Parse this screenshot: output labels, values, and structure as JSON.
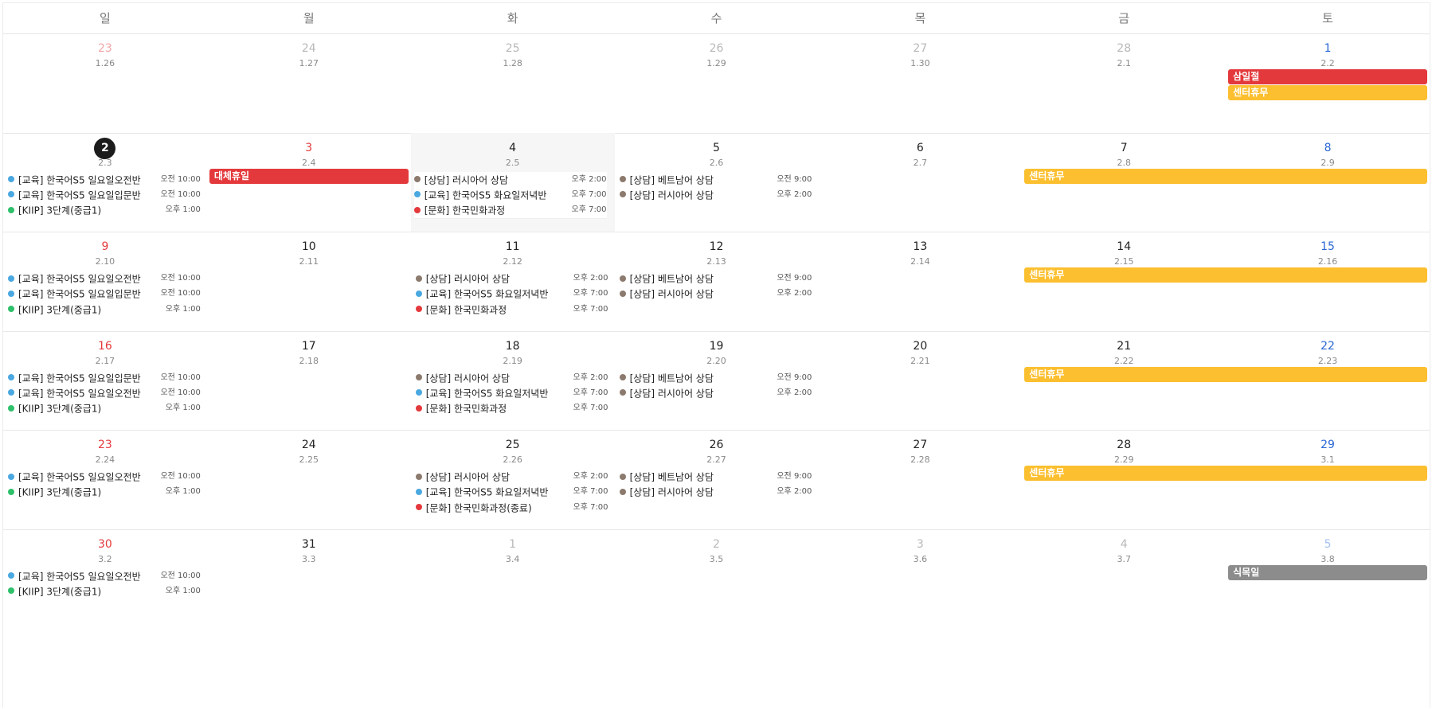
{
  "colors": {
    "edu": "#4aa8e0",
    "consult": "#8c7a6e",
    "kiip": "#2ec06a",
    "culture": "#e4393c",
    "holiday_red": "#e4393c",
    "closure_yellow": "#fcbf2f",
    "arbor_gray": "#8c8c8c"
  },
  "weekdays": [
    "일",
    "월",
    "화",
    "수",
    "목",
    "금",
    "토"
  ],
  "weeks": [
    {
      "days": [
        {
          "num": "23",
          "lunar": "1.26",
          "other": true
        },
        {
          "num": "24",
          "lunar": "1.27",
          "other": true
        },
        {
          "num": "25",
          "lunar": "1.28",
          "other": true
        },
        {
          "num": "26",
          "lunar": "1.29",
          "other": true
        },
        {
          "num": "27",
          "lunar": "1.30",
          "other": true
        },
        {
          "num": "28",
          "lunar": "2.1",
          "other": true
        },
        {
          "num": "1",
          "lunar": "2.2",
          "other": false
        }
      ],
      "bars": [
        {
          "title": "삼일절",
          "startCol": 6,
          "span": 1,
          "lane": 0,
          "color": "holiday_red"
        },
        {
          "title": "센터휴무",
          "startCol": 6,
          "span": 1,
          "lane": 1,
          "color": "closure_yellow"
        }
      ],
      "events": []
    },
    {
      "days": [
        {
          "num": "2",
          "lunar": "2.3",
          "other": false,
          "today": true
        },
        {
          "num": "3",
          "lunar": "2.4",
          "other": false,
          "holiday": true
        },
        {
          "num": "4",
          "lunar": "2.5",
          "other": false,
          "highlight": true
        },
        {
          "num": "5",
          "lunar": "2.6",
          "other": false
        },
        {
          "num": "6",
          "lunar": "2.7",
          "other": false
        },
        {
          "num": "7",
          "lunar": "2.8",
          "other": false
        },
        {
          "num": "8",
          "lunar": "2.9",
          "other": false
        }
      ],
      "bars": [
        {
          "title": "대체휴일",
          "startCol": 1,
          "span": 1,
          "lane": 0,
          "color": "holiday_red"
        },
        {
          "title": "센터휴무",
          "startCol": 5,
          "span": 2,
          "lane": 0,
          "color": "closure_yellow"
        }
      ],
      "events": [
        {
          "col": 0,
          "lane": 0,
          "cat": "edu",
          "title": "[교육] 한국어S5 일요일오전반",
          "time": "오전 10:00"
        },
        {
          "col": 0,
          "lane": 1,
          "cat": "edu",
          "title": "[교육] 한국어S5 일요일입문반",
          "time": "오전 10:00"
        },
        {
          "col": 0,
          "lane": 2,
          "cat": "kiip",
          "title": "[KIIP] 3단계(중급1)",
          "time": "오후 1:00"
        },
        {
          "col": 2,
          "lane": 0,
          "cat": "consult",
          "title": "[상담] 러시아어 상담",
          "time": "오후 2:00",
          "boxed": true
        },
        {
          "col": 2,
          "lane": 1,
          "cat": "edu",
          "title": "[교육] 한국어S5 화요일저녁반",
          "time": "오후 7:00",
          "boxed": true
        },
        {
          "col": 2,
          "lane": 2,
          "cat": "culture",
          "title": "[문화] 한국민화과정",
          "time": "오후 7:00",
          "boxed": true
        },
        {
          "col": 3,
          "lane": 0,
          "cat": "consult",
          "title": "[상담] 베트남어 상담",
          "time": "오전 9:00"
        },
        {
          "col": 3,
          "lane": 1,
          "cat": "consult",
          "title": "[상담] 러시아어 상담",
          "time": "오후 2:00"
        }
      ]
    },
    {
      "days": [
        {
          "num": "9",
          "lunar": "2.10",
          "other": false
        },
        {
          "num": "10",
          "lunar": "2.11",
          "other": false
        },
        {
          "num": "11",
          "lunar": "2.12",
          "other": false
        },
        {
          "num": "12",
          "lunar": "2.13",
          "other": false
        },
        {
          "num": "13",
          "lunar": "2.14",
          "other": false
        },
        {
          "num": "14",
          "lunar": "2.15",
          "other": false
        },
        {
          "num": "15",
          "lunar": "2.16",
          "other": false
        }
      ],
      "bars": [
        {
          "title": "센터휴무",
          "startCol": 5,
          "span": 2,
          "lane": 0,
          "color": "closure_yellow"
        }
      ],
      "events": [
        {
          "col": 0,
          "lane": 0,
          "cat": "edu",
          "title": "[교육] 한국어S5 일요일오전반",
          "time": "오전 10:00"
        },
        {
          "col": 0,
          "lane": 1,
          "cat": "edu",
          "title": "[교육] 한국어S5 일요일입문반",
          "time": "오전 10:00"
        },
        {
          "col": 0,
          "lane": 2,
          "cat": "kiip",
          "title": "[KIIP] 3단계(중급1)",
          "time": "오후 1:00"
        },
        {
          "col": 2,
          "lane": 0,
          "cat": "consult",
          "title": "[상담] 러시아어 상담",
          "time": "오후 2:00"
        },
        {
          "col": 2,
          "lane": 1,
          "cat": "edu",
          "title": "[교육] 한국어S5 화요일저녁반",
          "time": "오후 7:00"
        },
        {
          "col": 2,
          "lane": 2,
          "cat": "culture",
          "title": "[문화] 한국민화과정",
          "time": "오후 7:00"
        },
        {
          "col": 3,
          "lane": 0,
          "cat": "consult",
          "title": "[상담] 베트남어 상담",
          "time": "오전 9:00"
        },
        {
          "col": 3,
          "lane": 1,
          "cat": "consult",
          "title": "[상담] 러시아어 상담",
          "time": "오후 2:00"
        }
      ]
    },
    {
      "days": [
        {
          "num": "16",
          "lunar": "2.17",
          "other": false
        },
        {
          "num": "17",
          "lunar": "2.18",
          "other": false
        },
        {
          "num": "18",
          "lunar": "2.19",
          "other": false
        },
        {
          "num": "19",
          "lunar": "2.20",
          "other": false
        },
        {
          "num": "20",
          "lunar": "2.21",
          "other": false
        },
        {
          "num": "21",
          "lunar": "2.22",
          "other": false
        },
        {
          "num": "22",
          "lunar": "2.23",
          "other": false
        }
      ],
      "bars": [
        {
          "title": "센터휴무",
          "startCol": 5,
          "span": 2,
          "lane": 0,
          "color": "closure_yellow"
        }
      ],
      "events": [
        {
          "col": 0,
          "lane": 0,
          "cat": "edu",
          "title": "[교육] 한국어S5 일요일입문반",
          "time": "오전 10:00"
        },
        {
          "col": 0,
          "lane": 1,
          "cat": "edu",
          "title": "[교육] 한국어S5 일요일오전반",
          "time": "오전 10:00"
        },
        {
          "col": 0,
          "lane": 2,
          "cat": "kiip",
          "title": "[KIIP] 3단계(중급1)",
          "time": "오후 1:00"
        },
        {
          "col": 2,
          "lane": 0,
          "cat": "consult",
          "title": "[상담] 러시아어 상담",
          "time": "오후 2:00"
        },
        {
          "col": 2,
          "lane": 1,
          "cat": "edu",
          "title": "[교육] 한국어S5 화요일저녁반",
          "time": "오후 7:00"
        },
        {
          "col": 2,
          "lane": 2,
          "cat": "culture",
          "title": "[문화] 한국민화과정",
          "time": "오후 7:00"
        },
        {
          "col": 3,
          "lane": 0,
          "cat": "consult",
          "title": "[상담] 베트남어 상담",
          "time": "오전 9:00"
        },
        {
          "col": 3,
          "lane": 1,
          "cat": "consult",
          "title": "[상담] 러시아어 상담",
          "time": "오후 2:00"
        }
      ]
    },
    {
      "days": [
        {
          "num": "23",
          "lunar": "2.24",
          "other": false
        },
        {
          "num": "24",
          "lunar": "2.25",
          "other": false
        },
        {
          "num": "25",
          "lunar": "2.26",
          "other": false
        },
        {
          "num": "26",
          "lunar": "2.27",
          "other": false
        },
        {
          "num": "27",
          "lunar": "2.28",
          "other": false
        },
        {
          "num": "28",
          "lunar": "2.29",
          "other": false
        },
        {
          "num": "29",
          "lunar": "3.1",
          "other": false
        }
      ],
      "bars": [
        {
          "title": "센터휴무",
          "startCol": 5,
          "span": 2,
          "lane": 0,
          "color": "closure_yellow"
        }
      ],
      "events": [
        {
          "col": 0,
          "lane": 0,
          "cat": "edu",
          "title": "[교육] 한국어S5 일요일오전반",
          "time": "오전 10:00"
        },
        {
          "col": 0,
          "lane": 1,
          "cat": "kiip",
          "title": "[KIIP] 3단계(중급1)",
          "time": "오후 1:00"
        },
        {
          "col": 2,
          "lane": 0,
          "cat": "consult",
          "title": "[상담] 러시아어 상담",
          "time": "오후 2:00"
        },
        {
          "col": 2,
          "lane": 1,
          "cat": "edu",
          "title": "[교육] 한국어S5 화요일저녁반",
          "time": "오후 7:00"
        },
        {
          "col": 2,
          "lane": 2,
          "cat": "culture",
          "title": "[문화] 한국민화과정(종료)",
          "time": "오후 7:00"
        },
        {
          "col": 3,
          "lane": 0,
          "cat": "consult",
          "title": "[상담] 베트남어 상담",
          "time": "오전 9:00"
        },
        {
          "col": 3,
          "lane": 1,
          "cat": "consult",
          "title": "[상담] 러시아어 상담",
          "time": "오후 2:00"
        }
      ]
    },
    {
      "days": [
        {
          "num": "30",
          "lunar": "3.2",
          "other": false
        },
        {
          "num": "31",
          "lunar": "3.3",
          "other": false
        },
        {
          "num": "1",
          "lunar": "3.4",
          "other": true
        },
        {
          "num": "2",
          "lunar": "3.5",
          "other": true
        },
        {
          "num": "3",
          "lunar": "3.6",
          "other": true
        },
        {
          "num": "4",
          "lunar": "3.7",
          "other": true
        },
        {
          "num": "5",
          "lunar": "3.8",
          "other": true
        }
      ],
      "bars": [
        {
          "title": "식목일",
          "startCol": 6,
          "span": 1,
          "lane": 0,
          "color": "arbor_gray"
        }
      ],
      "events": [
        {
          "col": 0,
          "lane": 0,
          "cat": "edu",
          "title": "[교육] 한국어S5 일요일오전반",
          "time": "오전 10:00"
        },
        {
          "col": 0,
          "lane": 1,
          "cat": "kiip",
          "title": "[KIIP] 3단계(중급1)",
          "time": "오후 1:00"
        }
      ]
    }
  ]
}
